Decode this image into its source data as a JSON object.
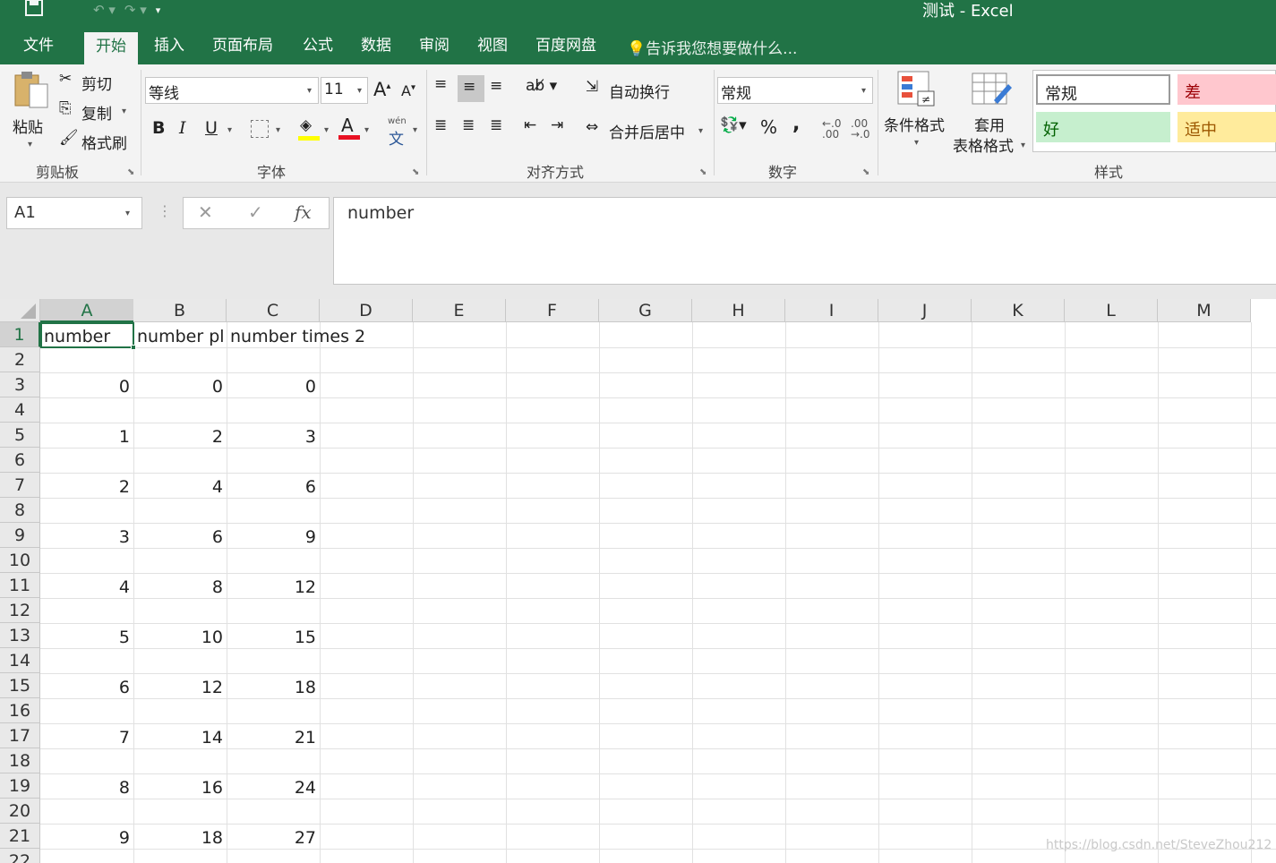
{
  "window": {
    "title": "测试 - Excel"
  },
  "qat": {
    "save_icon": "save-icon",
    "undo_icon": "undo-icon",
    "redo_icon": "redo-icon",
    "customize_icon": "customize-qat-icon"
  },
  "tabs": [
    "文件",
    "开始",
    "插入",
    "页面布局",
    "公式",
    "数据",
    "审阅",
    "视图",
    "百度网盘"
  ],
  "active_tab": "开始",
  "tell_me": "告诉我您想要做什么...",
  "ribbon": {
    "clipboard": {
      "paste": "粘贴",
      "cut": "剪切",
      "copy": "复制",
      "format_painter": "格式刷",
      "label": "剪贴板"
    },
    "font": {
      "name": "等线",
      "size": "11",
      "label": "字体",
      "grow": "A",
      "shrink": "A",
      "bold": "B",
      "italic": "I",
      "underline": "U",
      "phonetic_top": "wén",
      "phonetic_bottom": "文"
    },
    "alignment": {
      "wrap": "自动换行",
      "merge": "合并后居中",
      "label": "对齐方式"
    },
    "number": {
      "format": "常规",
      "percent": "%",
      "comma": ",",
      "inc_decimal": "←.0 .00",
      "dec_decimal": ".00 →.0",
      "label": "数字"
    },
    "styles": {
      "conditional": "条件格式",
      "table_line1": "套用",
      "table_line2": "表格格式",
      "normal": "常规",
      "bad": "差",
      "good": "好",
      "neutral": "适中",
      "label": "样式"
    }
  },
  "formula_bar": {
    "name_box": "A1",
    "cancel": "✕",
    "enter": "✓",
    "fx": "fx",
    "content": "number"
  },
  "columns": [
    "A",
    "B",
    "C",
    "D",
    "E",
    "F",
    "G",
    "H",
    "I",
    "J",
    "K",
    "L",
    "M"
  ],
  "rows": [
    "1",
    "2",
    "3",
    "4",
    "5",
    "6",
    "7",
    "8",
    "9",
    "10",
    "11",
    "12",
    "13",
    "14",
    "15",
    "16",
    "17",
    "18",
    "19",
    "20",
    "21",
    "22"
  ],
  "header_row": {
    "A": "number",
    "B": "number pl",
    "C": "number times 2"
  },
  "data_rows": [
    {
      "row": "3",
      "A": "0",
      "B": "0",
      "C": "0"
    },
    {
      "row": "5",
      "A": "1",
      "B": "2",
      "C": "3"
    },
    {
      "row": "7",
      "A": "2",
      "B": "4",
      "C": "6"
    },
    {
      "row": "9",
      "A": "3",
      "B": "6",
      "C": "9"
    },
    {
      "row": "11",
      "A": "4",
      "B": "8",
      "C": "12"
    },
    {
      "row": "13",
      "A": "5",
      "B": "10",
      "C": "15"
    },
    {
      "row": "15",
      "A": "6",
      "B": "12",
      "C": "18"
    },
    {
      "row": "17",
      "A": "7",
      "B": "14",
      "C": "21"
    },
    {
      "row": "19",
      "A": "8",
      "B": "16",
      "C": "24"
    },
    {
      "row": "21",
      "A": "9",
      "B": "18",
      "C": "27"
    }
  ],
  "watermark": "https://blog.csdn.net/SteveZhou212",
  "colors": {
    "accent": "#217346",
    "bad_bg": "#ffc7ce",
    "bad_fg": "#9c0006",
    "good_bg": "#c6efce",
    "good_fg": "#006100",
    "neutral_bg": "#ffeb9c",
    "neutral_fg": "#9c5700"
  }
}
